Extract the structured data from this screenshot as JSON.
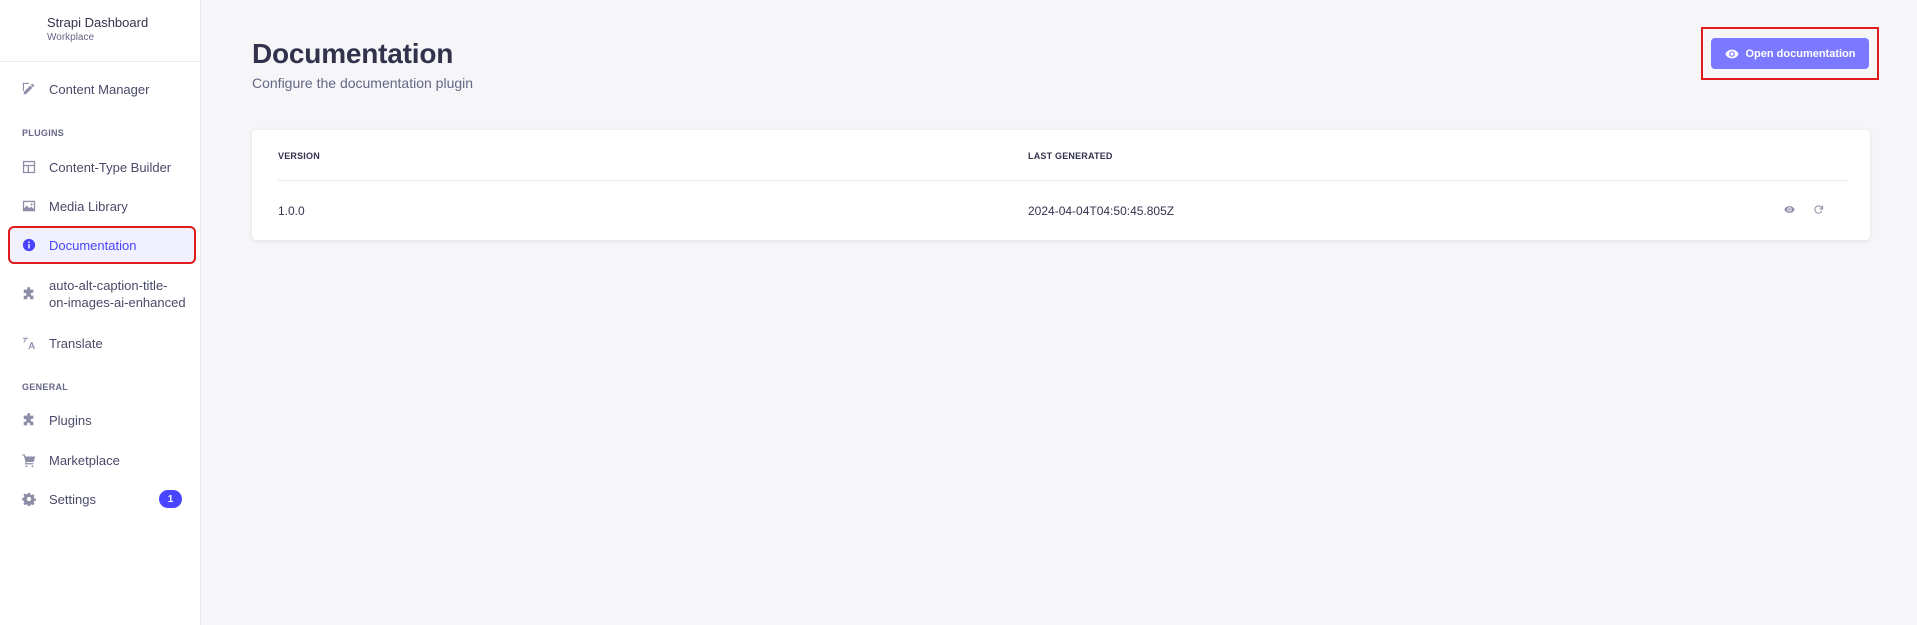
{
  "sidebar": {
    "brand_title": "Strapi Dashboard",
    "brand_subtitle": "Workplace",
    "content_manager": "Content Manager",
    "plugins_label": "PLUGINS",
    "plugins": [
      {
        "label": "Content-Type Builder",
        "icon": "layout-icon"
      },
      {
        "label": "Media Library",
        "icon": "image-icon"
      },
      {
        "label": "Documentation",
        "icon": "info-icon",
        "active": true
      },
      {
        "label_line1": "auto-alt-caption-title-",
        "label_line2": "on-images-ai-enhanced",
        "icon": "puzzle-icon"
      },
      {
        "label": "Translate",
        "icon": "translate-icon"
      }
    ],
    "general_label": "GENERAL",
    "general": [
      {
        "label": "Plugins",
        "icon": "puzzle-icon"
      },
      {
        "label": "Marketplace",
        "icon": "cart-icon"
      },
      {
        "label": "Settings",
        "icon": "gear-icon",
        "badge": "1"
      }
    ]
  },
  "header": {
    "title": "Documentation",
    "subtitle": "Configure the documentation plugin",
    "open_button": "Open documentation"
  },
  "table": {
    "columns": [
      "VERSION",
      "LAST GENERATED"
    ],
    "rows": [
      {
        "version": "1.0.0",
        "last_generated": "2024-04-04T04:50:45.805Z"
      }
    ]
  },
  "colors": {
    "accent": "#4945ff",
    "button": "#7b79ff",
    "highlight_box": "#e01b1b"
  }
}
